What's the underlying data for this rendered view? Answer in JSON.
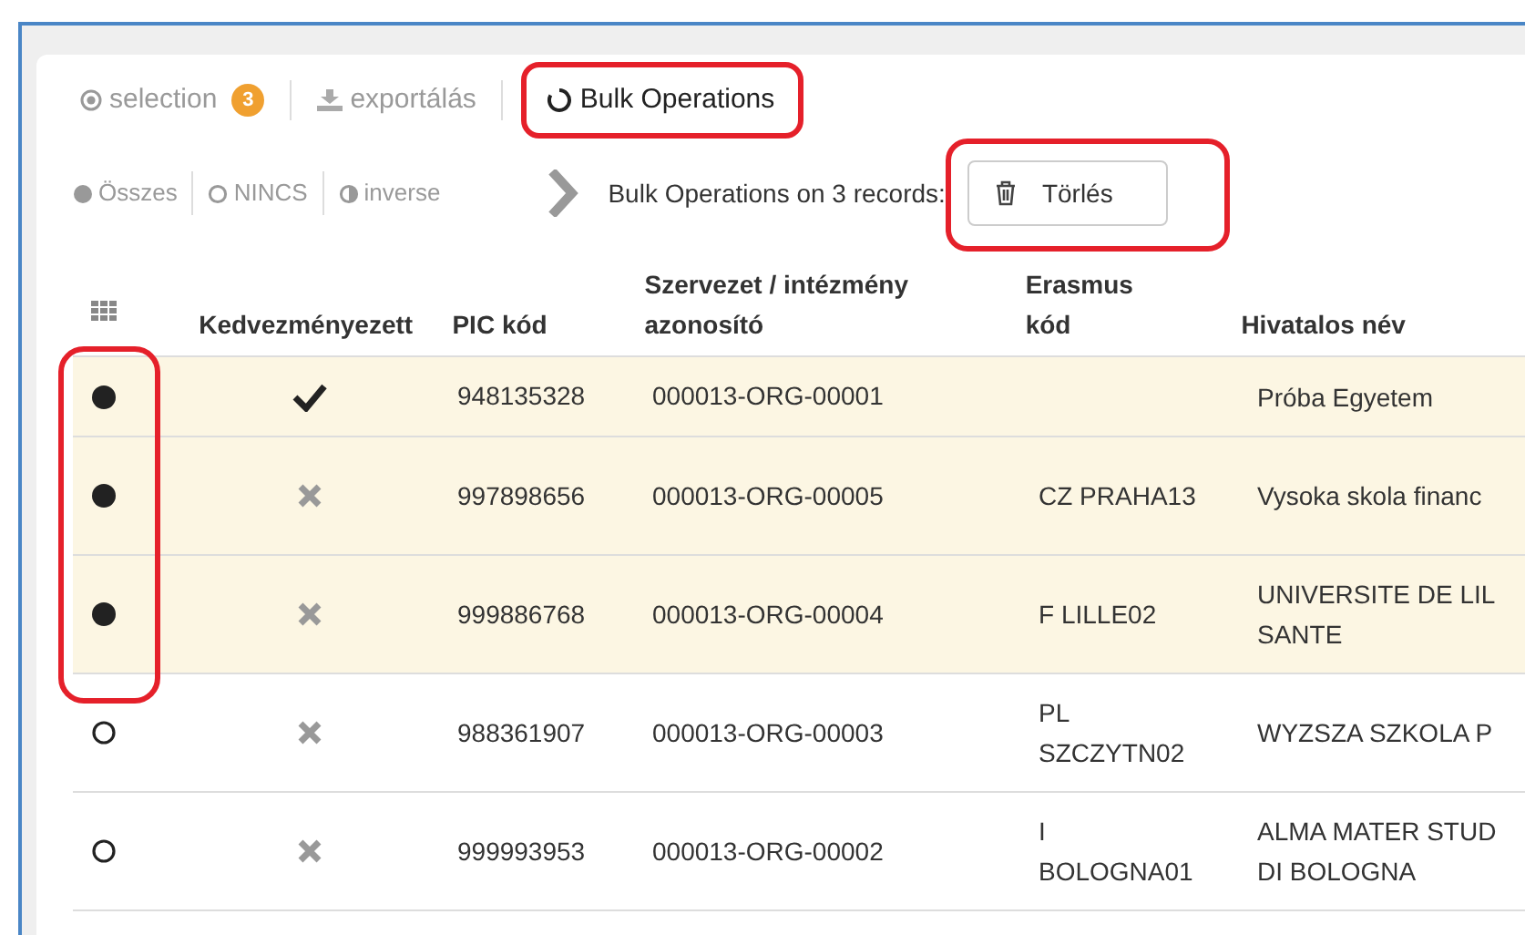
{
  "toolbar": {
    "tabs": [
      {
        "kind": "selection",
        "label": "selection",
        "badge": "3",
        "selected": false
      },
      {
        "kind": "export",
        "label": "exportálás",
        "selected": false
      },
      {
        "kind": "bulk",
        "label": "Bulk Operations",
        "selected": true
      }
    ]
  },
  "select_links": [
    {
      "kind": "all",
      "label": "Összes"
    },
    {
      "kind": "none",
      "label": "NINCS"
    },
    {
      "kind": "inverse",
      "label": "inverse"
    }
  ],
  "bulk_bar": {
    "label": "Bulk Operations on 3 records:",
    "delete_button": "Törlés"
  },
  "table": {
    "columns": [
      "Kedvezményezett",
      "PIC kód",
      "Szervezet / intézmény\nazonosító",
      "Erasmus\nkód",
      "Hivatalos név"
    ],
    "rows": [
      {
        "selected": true,
        "beneficiary": true,
        "pic": "948135328",
        "org_id": "000013-ORG-00001",
        "erasmus": "",
        "name": "Próba Egyetem"
      },
      {
        "selected": true,
        "beneficiary": false,
        "pic": "997898656",
        "org_id": "000013-ORG-00005",
        "erasmus": "CZ PRAHA13",
        "name": "Vysoka skola financ"
      },
      {
        "selected": true,
        "beneficiary": false,
        "pic": "999886768",
        "org_id": "000013-ORG-00004",
        "erasmus": "F LILLE02",
        "name": "UNIVERSITE DE LIL\nSANTE"
      },
      {
        "selected": false,
        "beneficiary": false,
        "pic": "988361907",
        "org_id": "000013-ORG-00003",
        "erasmus": "PL\nSZCZYTN02",
        "name": "WYZSZA SZKOLA P"
      },
      {
        "selected": false,
        "beneficiary": false,
        "pic": "999993953",
        "org_id": "000013-ORG-00002",
        "erasmus": "I\nBOLOGNA01",
        "name": "ALMA MATER STUD\nDI BOLOGNA"
      }
    ]
  }
}
